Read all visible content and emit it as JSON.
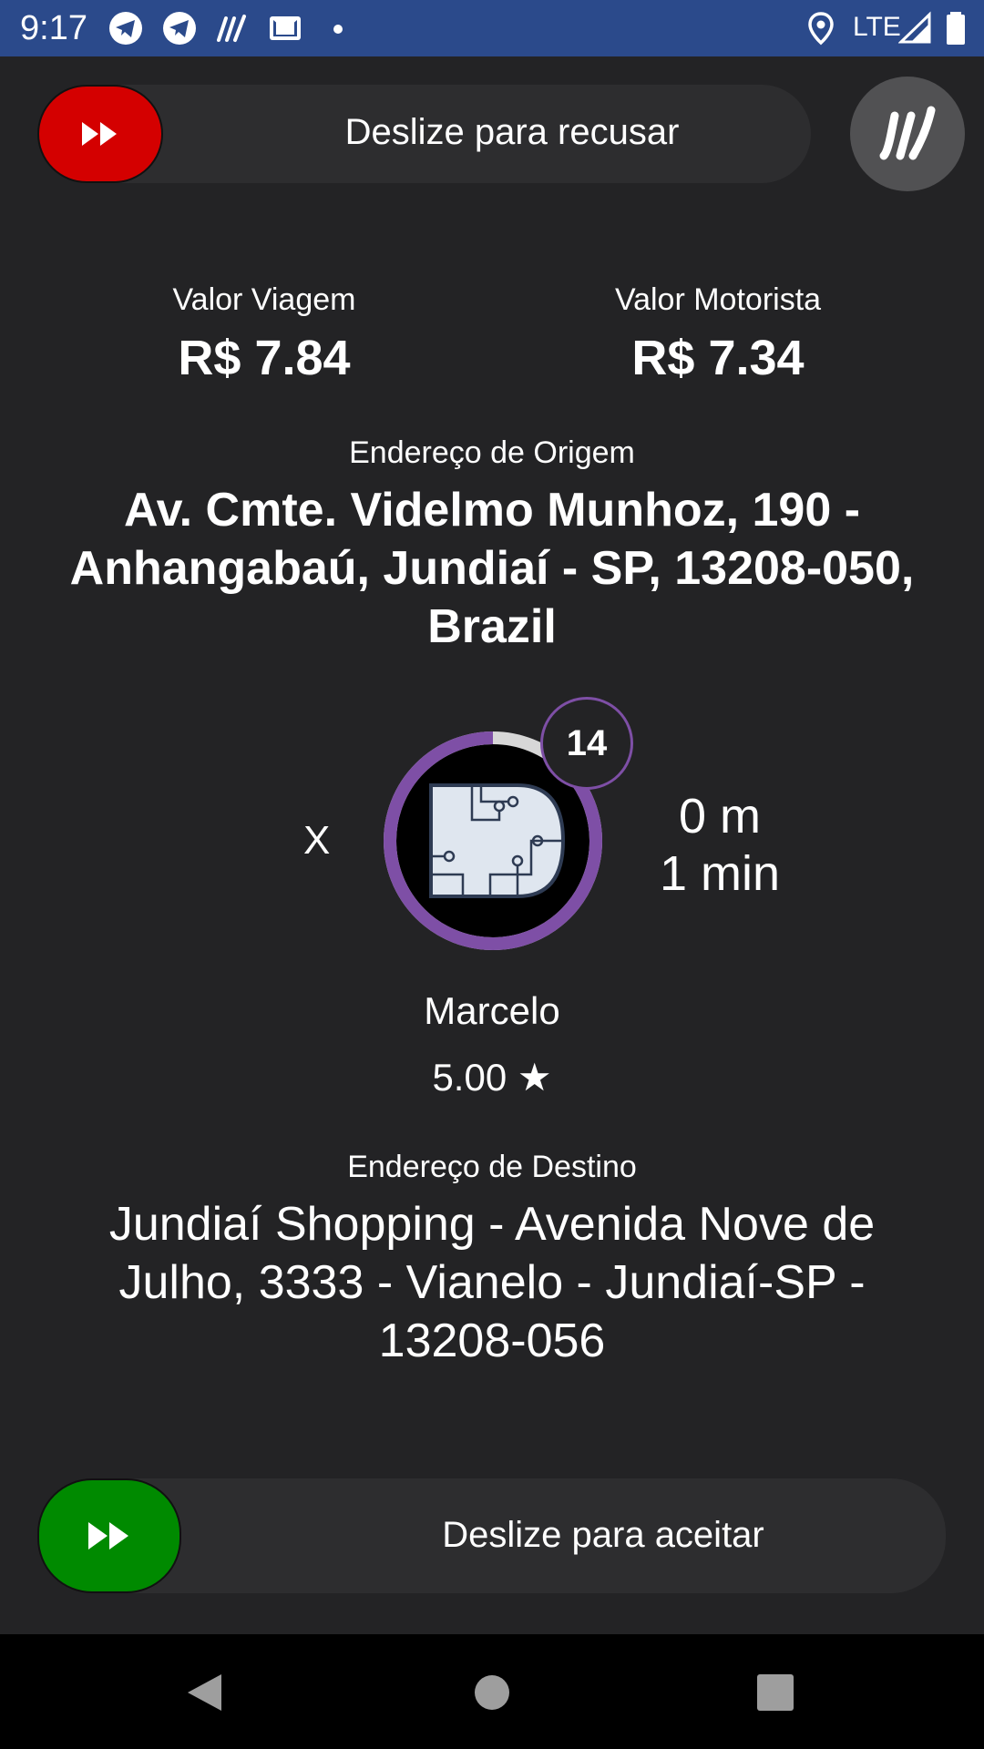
{
  "status_bar": {
    "time": "9:17",
    "network": "LTE",
    "icons": [
      "telegram-icon",
      "telegram-icon",
      "app-logo-icon",
      "gmail-icon",
      "dot-icon",
      "location-icon",
      "signal-icon",
      "battery-icon"
    ]
  },
  "reject_slider": {
    "label": "Deslize para recusar",
    "color": "#d40000"
  },
  "accept_slider": {
    "label": "Deslize para aceitar",
    "color": "#008a00"
  },
  "fares": {
    "trip_label": "Valor Viagem",
    "trip_value": "R$ 7.84",
    "driver_label": "Valor Motorista",
    "driver_value": "R$ 7.34"
  },
  "origin": {
    "label": "Endereço de Origem",
    "address": "Av. Cmte. Videlmo Munhoz, 190 - Anhangabaú, Jundiaí - SP, 13208-050, Brazil"
  },
  "request": {
    "close_label": "X",
    "timer": "14",
    "countdown_fraction": 0.88,
    "distance": "0 m",
    "duration": "1 min",
    "accent_color": "#7e4fa6"
  },
  "passenger": {
    "name": "Marcelo",
    "rating": "5.00 ★"
  },
  "destination": {
    "label": "Endereço de Destino",
    "address": "Jundiaí Shopping - Avenida Nove de Julho, 3333 - Vianelo - Jundiaí-SP - 13208-056"
  }
}
